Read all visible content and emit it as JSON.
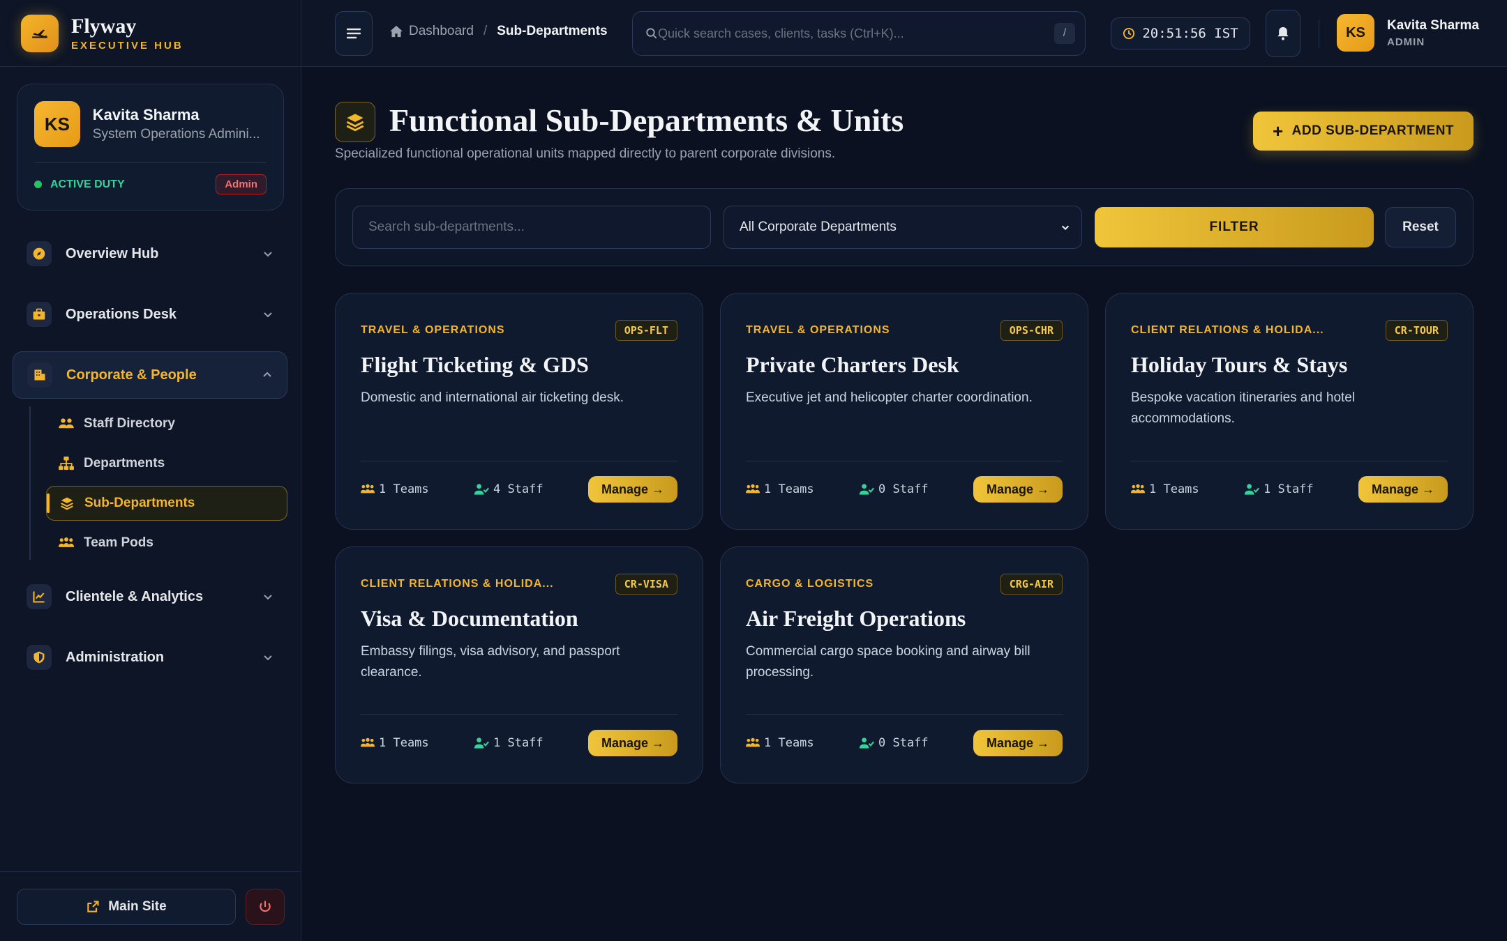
{
  "brand": {
    "name": "Flyway",
    "subtitle": "EXECUTIVE HUB"
  },
  "profile": {
    "initials": "KS",
    "name": "Kavita Sharma",
    "role": "System Operations Admini...",
    "status": "ACTIVE DUTY",
    "badge": "Admin"
  },
  "sidebar": {
    "items": [
      {
        "label": "Overview Hub",
        "icon": "compass-icon"
      },
      {
        "label": "Operations Desk",
        "icon": "briefcase-icon"
      },
      {
        "label": "Corporate & People",
        "icon": "building-icon"
      },
      {
        "label": "Clientele & Analytics",
        "icon": "chart-icon"
      },
      {
        "label": "Administration",
        "icon": "shield-icon"
      }
    ],
    "subitems": [
      {
        "label": "Staff Directory",
        "icon": "users-icon"
      },
      {
        "label": "Departments",
        "icon": "sitemap-icon"
      },
      {
        "label": "Sub-Departments",
        "icon": "layers-icon"
      },
      {
        "label": "Team Pods",
        "icon": "people-group-icon"
      }
    ],
    "footer": {
      "main_site": "Main Site"
    }
  },
  "topbar": {
    "breadcrumb": {
      "home": "Dashboard",
      "current": "Sub-Departments"
    },
    "search_placeholder": "Quick search cases, clients, tasks (Ctrl+K)...",
    "search_shortcut": "/",
    "clock": "20:51:56 IST",
    "user": {
      "initials": "KS",
      "name": "Kavita Sharma",
      "role": "ADMIN"
    }
  },
  "page": {
    "title": "Functional Sub-Departments & Units",
    "subtitle": "Specialized functional operational units mapped directly to parent corporate divisions.",
    "add_button": "ADD SUB-DEPARTMENT"
  },
  "filters": {
    "search_placeholder": "Search sub-departments...",
    "select_value": "All Corporate Departments",
    "filter_label": "FILTER",
    "reset_label": "Reset"
  },
  "cards": [
    {
      "category": "TRAVEL & OPERATIONS",
      "code": "OPS-FLT",
      "title": "Flight Ticketing & GDS",
      "description": "Domestic and international air ticketing desk.",
      "teams": "1 Teams",
      "staff": "4 Staff",
      "action": "Manage →"
    },
    {
      "category": "TRAVEL & OPERATIONS",
      "code": "OPS-CHR",
      "title": "Private Charters Desk",
      "description": "Executive jet and helicopter charter coordination.",
      "teams": "1 Teams",
      "staff": "0 Staff",
      "action": "Manage →"
    },
    {
      "category": "CLIENT RELATIONS & HOLIDA...",
      "code": "CR-TOUR",
      "title": "Holiday Tours & Stays",
      "description": "Bespoke vacation itineraries and hotel accommodations.",
      "teams": "1 Teams",
      "staff": "1 Staff",
      "action": "Manage →"
    },
    {
      "category": "CLIENT RELATIONS & HOLIDA...",
      "code": "CR-VISA",
      "title": "Visa & Documentation",
      "description": "Embassy filings, visa advisory, and passport clearance.",
      "teams": "1 Teams",
      "staff": "1 Staff",
      "action": "Manage →"
    },
    {
      "category": "CARGO & LOGISTICS",
      "code": "CRG-AIR",
      "title": "Air Freight Operations",
      "description": "Commercial cargo space booking and airway bill processing.",
      "teams": "1 Teams",
      "staff": "0 Staff",
      "action": "Manage →"
    }
  ],
  "colors": {
    "accent": "#f5b52a",
    "background": "#0b1120",
    "success": "#34d399",
    "danger": "#f87171"
  }
}
